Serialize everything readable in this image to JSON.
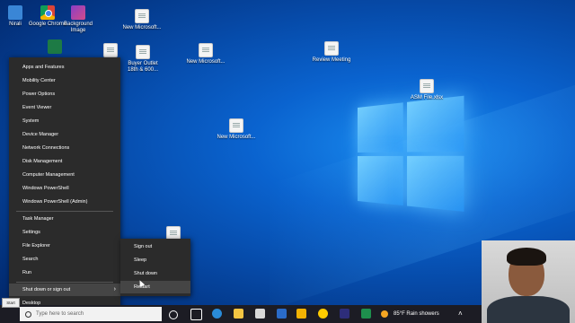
{
  "desktop_icons": [
    {
      "name": "nirali",
      "label": "Nirali",
      "icon": "user-folder-icon"
    },
    {
      "name": "google-chrome",
      "label": "Google Chrome",
      "icon": "chrome-icon"
    },
    {
      "name": "background-image",
      "label": "Background Image",
      "icon": "image-icon"
    },
    {
      "name": "new-microsoft-1",
      "label": "New Microsoft...",
      "icon": "document-icon"
    },
    {
      "name": "buyer-outlet",
      "label": "Buyer Outlet 18th & 600...",
      "icon": "document-icon"
    },
    {
      "name": "new-microsoft-2",
      "label": "New Microsoft...",
      "icon": "document-icon"
    },
    {
      "name": "review-meeting",
      "label": "Review Meeting",
      "icon": "document-icon"
    },
    {
      "name": "asm-file",
      "label": "ASM File.xlsx",
      "icon": "document-icon"
    },
    {
      "name": "new-microsoft-3",
      "label": "New Microsoft...",
      "icon": "document-icon"
    }
  ],
  "winx_menu": {
    "items": [
      "Apps and Features",
      "Mobility Center",
      "Power Options",
      "Event Viewer",
      "System",
      "Device Manager",
      "Network Connections",
      "Disk Management",
      "Computer Management",
      "Windows PowerShell",
      "Windows PowerShell (Admin)",
      "Task Manager",
      "Settings",
      "File Explorer",
      "Search",
      "Run",
      "Shut down or sign out",
      "Desktop"
    ]
  },
  "submenu": {
    "items": [
      "Sign out",
      "Sleep",
      "Shut down",
      "Restart"
    ]
  },
  "taskbar": {
    "start_label": "Start",
    "search_placeholder": "Type here to search",
    "weather": "85°F  Rain showers"
  },
  "colors": {
    "menu_bg": "#2b2b2b",
    "taskbar_bg": "#1c1c24",
    "accent": "#0a63cf"
  }
}
